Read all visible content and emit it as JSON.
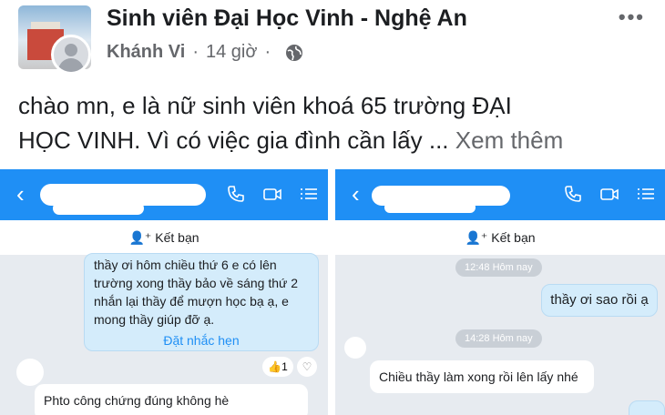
{
  "post": {
    "group_name": "Sinh viên Đại Học Vinh - Nghệ An",
    "author": "Khánh Vi",
    "time": "14 giờ",
    "text_line1": "chào mn, e là nữ sinh viên khoá 65 trường ĐẠI",
    "text_line2": "HỌC VINH. Vì có việc gia đình cần lấy ...",
    "see_more": "Xem thêm",
    "more_icon": "more-icon",
    "privacy_icon": "globe-icon"
  },
  "left_chat": {
    "add_friend": "Kết bạn",
    "message1_lines": [
      "thầy ơi hôm chiều thứ 6 e có lên",
      "trường xong thầy bảo về sáng thứ 2",
      "nhắn lại thầy để mượn học bạ ạ, e",
      "mong thầy giúp đỡ ạ."
    ],
    "remind": "Đặt nhắc hẹn",
    "reaction_count": "1",
    "message2": "Phto công chứng đúng không hè"
  },
  "right_chat": {
    "add_friend": "Kết bạn",
    "time1": "12:48 Hôm nay",
    "message_out": "thầy ơi sao rồi ạ",
    "time2": "14:28 Hôm nay",
    "message_in": "Chiều thầy làm xong rồi lên lấy nhé"
  },
  "colors": {
    "header_blue": "#1f8ff5",
    "bubble_blue": "#d4ecfb",
    "chat_bg": "#e7ebf0"
  }
}
